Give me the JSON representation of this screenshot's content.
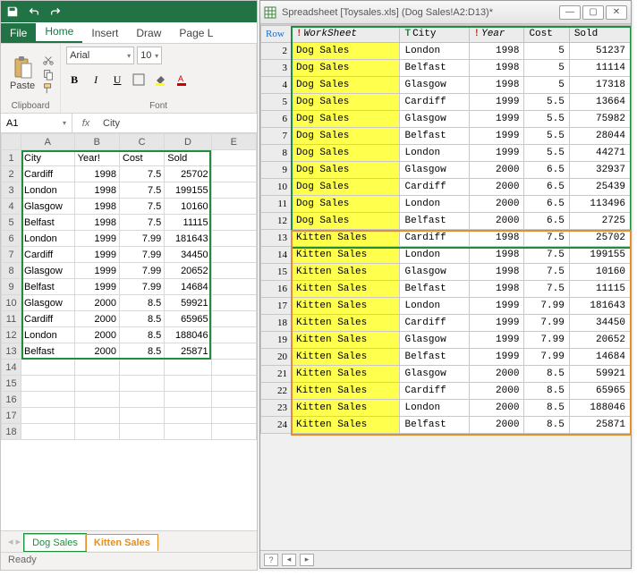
{
  "excel": {
    "tabs": {
      "file": "File",
      "home": "Home",
      "insert": "Insert",
      "draw": "Draw",
      "page": "Page L"
    },
    "ribbon": {
      "clipboard_label": "Clipboard",
      "paste_label": "Paste",
      "font_label": "Font",
      "font_name": "Arial",
      "font_size": "10"
    },
    "namebox": "A1",
    "formula": "City",
    "columns": [
      "A",
      "B",
      "C",
      "D",
      "E"
    ],
    "headers": [
      "City",
      "Year!",
      "Cost",
      "Sold"
    ],
    "rows": [
      {
        "city": "Cardiff",
        "year": 1998,
        "cost": 7.5,
        "sold": 25702
      },
      {
        "city": "London",
        "year": 1998,
        "cost": 7.5,
        "sold": 199155
      },
      {
        "city": "Glasgow",
        "year": 1998,
        "cost": 7.5,
        "sold": 10160
      },
      {
        "city": "Belfast",
        "year": 1998,
        "cost": 7.5,
        "sold": 11115
      },
      {
        "city": "London",
        "year": 1999,
        "cost": 7.99,
        "sold": 181643
      },
      {
        "city": "Cardiff",
        "year": 1999,
        "cost": 7.99,
        "sold": 34450
      },
      {
        "city": "Glasgow",
        "year": 1999,
        "cost": 7.99,
        "sold": 20652
      },
      {
        "city": "Belfast",
        "year": 1999,
        "cost": 7.99,
        "sold": 14684
      },
      {
        "city": "Glasgow",
        "year": 2000,
        "cost": 8.5,
        "sold": 59921
      },
      {
        "city": "Cardiff",
        "year": 2000,
        "cost": 8.5,
        "sold": 65965
      },
      {
        "city": "London",
        "year": 2000,
        "cost": 8.5,
        "sold": 188046
      },
      {
        "city": "Belfast",
        "year": 2000,
        "cost": 8.5,
        "sold": 25871
      }
    ],
    "blank_rows": [
      14,
      15,
      16,
      17,
      18
    ],
    "sheet_tabs": {
      "dog": "Dog Sales",
      "kitten": "Kitten Sales"
    },
    "status": "Ready"
  },
  "tool": {
    "title": "Spreadsheet [Toysales.xls] (Dog Sales!A2:D13)*",
    "headers": {
      "row": "Row",
      "worksheet": "WorkSheet",
      "city": "City",
      "year": "Year",
      "cost": "Cost",
      "sold": "Sold"
    },
    "rows": [
      {
        "n": 2,
        "ws": "Dog Sales",
        "city": "London",
        "year": 1998,
        "cost": 5,
        "sold": 51237
      },
      {
        "n": 3,
        "ws": "Dog Sales",
        "city": "Belfast",
        "year": 1998,
        "cost": 5,
        "sold": 11114
      },
      {
        "n": 4,
        "ws": "Dog Sales",
        "city": "Glasgow",
        "year": 1998,
        "cost": 5,
        "sold": 17318
      },
      {
        "n": 5,
        "ws": "Dog Sales",
        "city": "Cardiff",
        "year": 1999,
        "cost": 5.5,
        "sold": 13664
      },
      {
        "n": 6,
        "ws": "Dog Sales",
        "city": "Glasgow",
        "year": 1999,
        "cost": 5.5,
        "sold": 75982
      },
      {
        "n": 7,
        "ws": "Dog Sales",
        "city": "Belfast",
        "year": 1999,
        "cost": 5.5,
        "sold": 28044
      },
      {
        "n": 8,
        "ws": "Dog Sales",
        "city": "London",
        "year": 1999,
        "cost": 5.5,
        "sold": 44271
      },
      {
        "n": 9,
        "ws": "Dog Sales",
        "city": "Glasgow",
        "year": 2000,
        "cost": 6.5,
        "sold": 32937
      },
      {
        "n": 10,
        "ws": "Dog Sales",
        "city": "Cardiff",
        "year": 2000,
        "cost": 6.5,
        "sold": 25439
      },
      {
        "n": 11,
        "ws": "Dog Sales",
        "city": "London",
        "year": 2000,
        "cost": 6.5,
        "sold": 113496
      },
      {
        "n": 12,
        "ws": "Dog Sales",
        "city": "Belfast",
        "year": 2000,
        "cost": 6.5,
        "sold": 2725
      },
      {
        "n": 13,
        "ws": "Kitten Sales",
        "city": "Cardiff",
        "year": 1998,
        "cost": 7.5,
        "sold": 25702
      },
      {
        "n": 14,
        "ws": "Kitten Sales",
        "city": "London",
        "year": 1998,
        "cost": 7.5,
        "sold": 199155
      },
      {
        "n": 15,
        "ws": "Kitten Sales",
        "city": "Glasgow",
        "year": 1998,
        "cost": 7.5,
        "sold": 10160
      },
      {
        "n": 16,
        "ws": "Kitten Sales",
        "city": "Belfast",
        "year": 1998,
        "cost": 7.5,
        "sold": 11115
      },
      {
        "n": 17,
        "ws": "Kitten Sales",
        "city": "London",
        "year": 1999,
        "cost": 7.99,
        "sold": 181643
      },
      {
        "n": 18,
        "ws": "Kitten Sales",
        "city": "Cardiff",
        "year": 1999,
        "cost": 7.99,
        "sold": 34450
      },
      {
        "n": 19,
        "ws": "Kitten Sales",
        "city": "Glasgow",
        "year": 1999,
        "cost": 7.99,
        "sold": 20652
      },
      {
        "n": 20,
        "ws": "Kitten Sales",
        "city": "Belfast",
        "year": 1999,
        "cost": 7.99,
        "sold": 14684
      },
      {
        "n": 21,
        "ws": "Kitten Sales",
        "city": "Glasgow",
        "year": 2000,
        "cost": 8.5,
        "sold": 59921
      },
      {
        "n": 22,
        "ws": "Kitten Sales",
        "city": "Cardiff",
        "year": 2000,
        "cost": 8.5,
        "sold": 65965
      },
      {
        "n": 23,
        "ws": "Kitten Sales",
        "city": "London",
        "year": 2000,
        "cost": 8.5,
        "sold": 188046
      },
      {
        "n": 24,
        "ws": "Kitten Sales",
        "city": "Belfast",
        "year": 2000,
        "cost": 8.5,
        "sold": 25871
      }
    ],
    "status_q": "?"
  },
  "colors": {
    "excel_green": "#217346",
    "highlight_green": "#1e8e3e",
    "highlight_orange": "#e38e27",
    "yellow": "#ffff4d"
  }
}
